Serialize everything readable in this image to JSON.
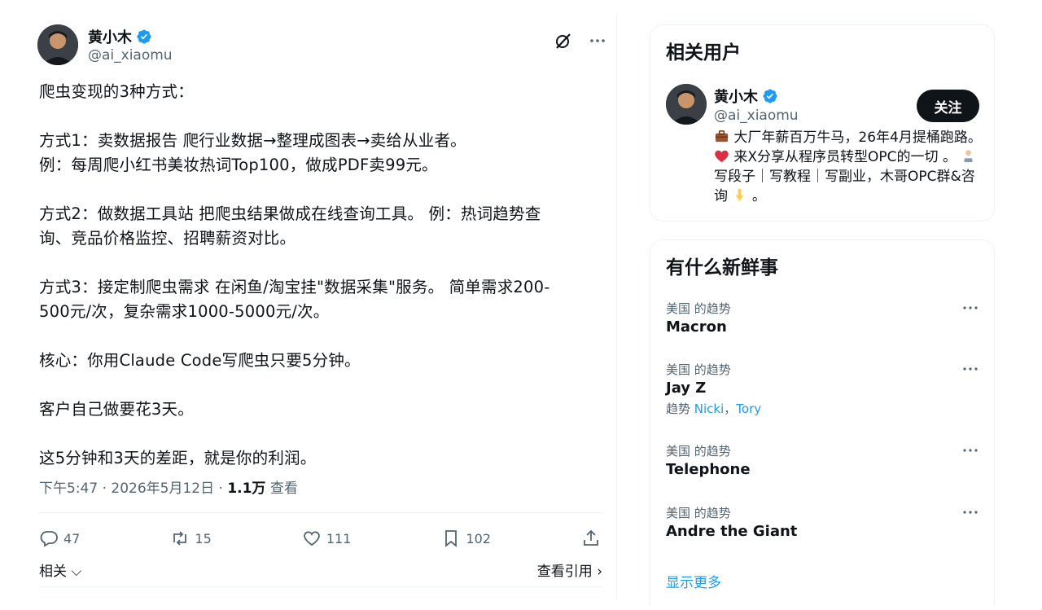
{
  "tweet": {
    "author_name": "黄小木",
    "author_handle": "@ai_xiaomu",
    "body": "爬虫变现的3种方式：\n\n方式1：卖数据报告 爬行业数据→整理成图表→卖给从业者。\n例：每周爬小红书美妆热词Top100，做成PDF卖99元。\n\n方式2：做数据工具站 把爬虫结果做成在线查询工具。 例：热词趋势查\n询、竞品价格监控、招聘薪资对比。\n\n方式3：接定制爬虫需求 在闲鱼/淘宝挂\"数据采集\"服务。 简单需求200-\n500元/次，复杂需求1000-5000元/次。\n\n核心：你用Claude Code写爬虫只要5分钟。\n\n客户自己做要花3天。\n\n这5分钟和3天的差距，就是你的利润。",
    "time": "下午5:47 · 2026年5月12日 · ",
    "views_count": "1.1万",
    "views_label": " 查看",
    "replies": "47",
    "retweets": "15",
    "likes": "111",
    "bookmarks": "102",
    "related_label": "相关",
    "quotes_label": "查看引用"
  },
  "related_users": {
    "title": "相关用户",
    "user": {
      "name": "黄小木",
      "handle": "@ai_xiaomu",
      "follow_label": "关注",
      "bio_part1": "大厂年薪百万牛马，26年4月提桶跑路。",
      "bio_part2": "来X分享从程序员转型OPC的一切 。",
      "bio_part3": "写段子｜写教程｜写副业，木哥OPC群&咨询",
      "bio_part4": "。"
    }
  },
  "trends": {
    "title": "有什么新鲜事",
    "items": [
      {
        "context": "美国 的趋势",
        "name": "Macron"
      },
      {
        "context": "美国 的趋势",
        "name": "Jay Z",
        "sub_prefix": "趋势 ",
        "sub_link1": "Nicki",
        "sub_sep": "，",
        "sub_link2": "Tory"
      },
      {
        "context": "美国 的趋势",
        "name": "Telephone"
      },
      {
        "context": "美国 的趋势",
        "name": "Andre the Giant"
      }
    ],
    "show_more": "显示更多"
  },
  "icons": {
    "verified": "verified-badge-icon",
    "grok": "grok-icon",
    "more": "more-dots-icon",
    "reply": "reply-icon",
    "retweet": "retweet-icon",
    "like": "heart-icon",
    "bookmark": "bookmark-icon",
    "share": "share-icon",
    "briefcase": "briefcase-emoji",
    "heart": "red-heart-emoji",
    "technologist": "technologist-emoji",
    "point_down": "pointing-down-emoji"
  },
  "colors": {
    "accent": "#1d9bf0",
    "text": "#0f1419",
    "muted": "#536471",
    "follow_bg": "#0f1419"
  }
}
